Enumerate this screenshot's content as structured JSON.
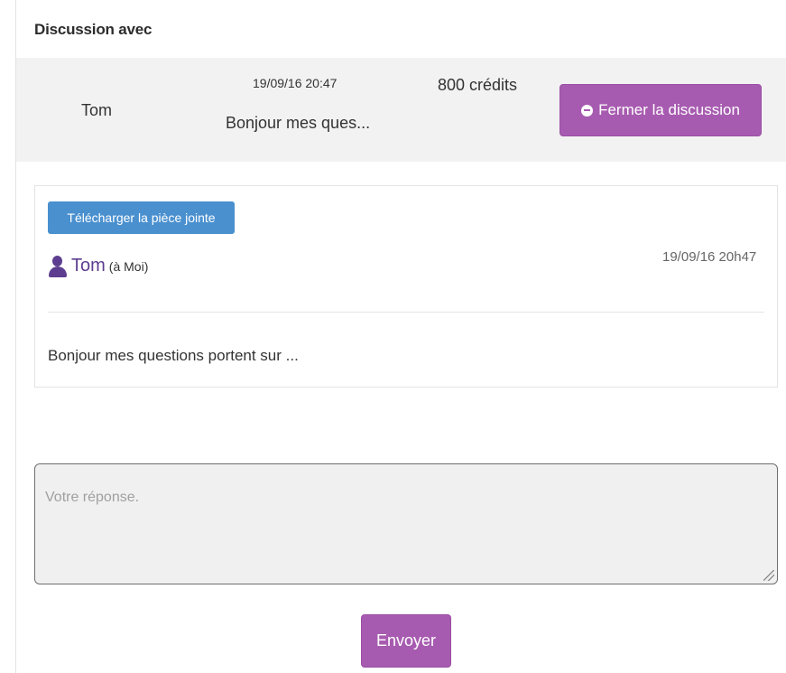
{
  "page": {
    "title": "Discussion avec"
  },
  "discussion_header": {
    "name": "Tom",
    "date": "19/09/16 20:47",
    "preview": "Bonjour mes ques...",
    "credits": "800 crédits",
    "close_label": "Fermer la discussion",
    "close_icon": "minus-circle-icon"
  },
  "message": {
    "attachment_label": "Télécharger la pièce jointe",
    "sender_icon": "user-icon",
    "sender_name": "Tom",
    "sender_suffix": "(à Moi)",
    "timestamp": "19/09/16 20h47",
    "body": "Bonjour mes questions portent sur ..."
  },
  "reply": {
    "value": "",
    "placeholder": "Votre réponse.",
    "send_label": "Envoyer"
  },
  "colors": {
    "accent_purple": "#a75bb0",
    "attachment_blue": "#4a90cf",
    "sender_purple": "#5d3d8f",
    "header_bg": "#f2f2f2"
  }
}
